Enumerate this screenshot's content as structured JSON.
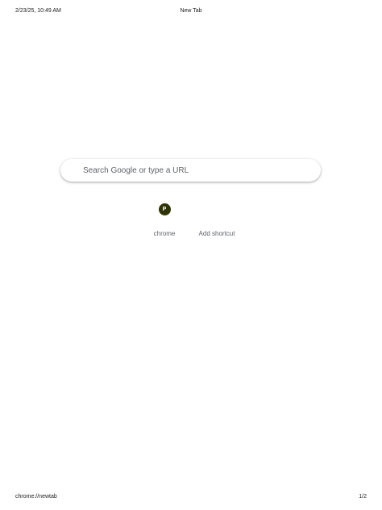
{
  "print_header": {
    "datetime": "2/23/25, 10:49 AM",
    "title": "New Tab"
  },
  "print_footer": {
    "url": "chrome://newtab",
    "page": "1/2"
  },
  "search": {
    "placeholder": "Search Google or type a URL"
  },
  "shortcuts": [
    {
      "letter": "P",
      "label": "chrome",
      "icon_color": "#2f3307"
    },
    {
      "label": "Add shortcut"
    }
  ]
}
